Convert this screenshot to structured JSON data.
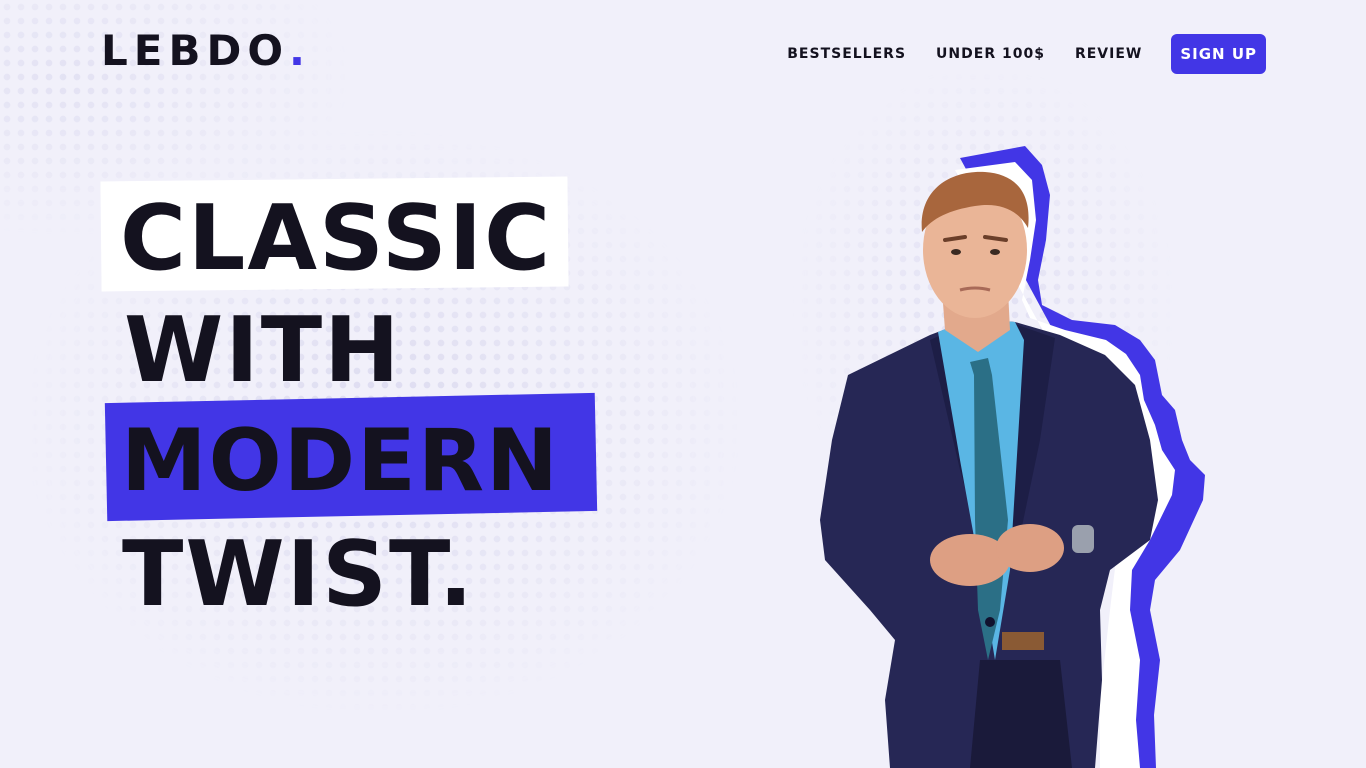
{
  "brand": {
    "name": "LEBDO",
    "dot": ".",
    "accent_color": "#4236e6",
    "text_color": "#14121f",
    "background_color": "#f1f0fa"
  },
  "nav": {
    "items": [
      {
        "label": "BESTSELLERS"
      },
      {
        "label": "UNDER 100$"
      },
      {
        "label": "REVIEW"
      }
    ],
    "signup_label": "SIGN UP"
  },
  "hero": {
    "lines": [
      "CLASSIC",
      "WITH",
      "MODERN",
      "TWIST."
    ],
    "highlight_white_line": "CLASSIC",
    "highlight_accent_line": "MODERN",
    "image_subject": "man in navy suit with blue torn-paper outline"
  }
}
